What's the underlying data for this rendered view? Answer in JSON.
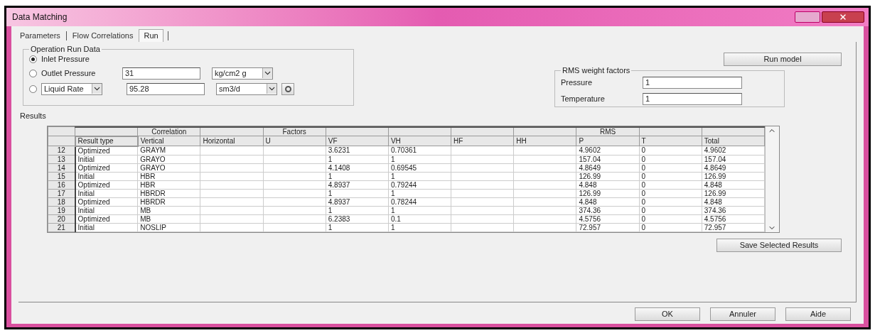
{
  "window": {
    "title": "Data Matching"
  },
  "tabs": [
    {
      "label": "Parameters",
      "selected": false
    },
    {
      "label": "Flow Correlations",
      "selected": false
    },
    {
      "label": "Run",
      "selected": true
    }
  ],
  "operation_run_data": {
    "title": "Operation Run Data",
    "options": [
      {
        "kind": "plain",
        "label": "Inlet Pressure",
        "selected": true
      },
      {
        "kind": "field",
        "label": "Outlet Pressure",
        "selected": false,
        "value": "31",
        "unit": "kg/cm2 g"
      },
      {
        "kind": "quantity",
        "label": "Liquid Rate",
        "selected": false,
        "value": "95.28",
        "unit": "sm3/d"
      }
    ]
  },
  "run_model_button": "Run model",
  "rms_weight_factors": {
    "title": "RMS weight factors",
    "fields": [
      {
        "label": "Pressure",
        "value": "1"
      },
      {
        "label": "Temperature",
        "value": "1"
      }
    ]
  },
  "results": {
    "title": "Results",
    "columns": [
      {
        "label": "Result type"
      },
      {
        "label": "Vertical",
        "group": "Correlation"
      },
      {
        "label": "Horizontal"
      },
      {
        "label": "U",
        "group": "Factors"
      },
      {
        "label": "VF"
      },
      {
        "label": "VH"
      },
      {
        "label": "HF"
      },
      {
        "label": "HH"
      },
      {
        "label": "P",
        "group": "RMS"
      },
      {
        "label": "T"
      },
      {
        "label": "Total"
      }
    ],
    "rows": [
      {
        "number": "12",
        "cells": [
          "Optimized",
          "GRAYM",
          null,
          null,
          "3.6231",
          "0.70361",
          null,
          null,
          "4.9602",
          "0",
          "4.9602"
        ]
      },
      {
        "number": "13",
        "cells": [
          "Initial",
          "GRAYO",
          null,
          null,
          "1",
          "1",
          null,
          null,
          "157.04",
          "0",
          "157.04"
        ]
      },
      {
        "number": "14",
        "cells": [
          "Optimized",
          "GRAYO",
          null,
          null,
          "4.1408",
          "0.69545",
          null,
          null,
          "4.8649",
          "0",
          "4.8649"
        ]
      },
      {
        "number": "15",
        "cells": [
          "Initial",
          "HBR",
          null,
          null,
          "1",
          "1",
          null,
          null,
          "126.99",
          "0",
          "126.99"
        ]
      },
      {
        "number": "16",
        "cells": [
          "Optimized",
          "HBR",
          null,
          null,
          "4.8937",
          "0.79244",
          null,
          null,
          "4.848",
          "0",
          "4.848"
        ]
      },
      {
        "number": "17",
        "cells": [
          "Initial",
          "HBRDR",
          null,
          null,
          "1",
          "1",
          null,
          null,
          "126.99",
          "0",
          "126.99"
        ]
      },
      {
        "number": "18",
        "cells": [
          "Optimized",
          "HBRDR",
          null,
          null,
          "4.8937",
          "0.78244",
          null,
          null,
          "4.848",
          "0",
          "4.848"
        ]
      },
      {
        "number": "19",
        "cells": [
          "Initial",
          "MB",
          null,
          null,
          "1",
          "1",
          null,
          null,
          "374.36",
          "0",
          "374.36"
        ]
      },
      {
        "number": "20",
        "cells": [
          "Optimized",
          "MB",
          null,
          null,
          "6.2383",
          "0.1",
          null,
          null,
          "4.5756",
          "0",
          "4.5756"
        ]
      },
      {
        "number": "21",
        "cells": [
          "Initial",
          "NOSLIP",
          null,
          null,
          "1",
          "1",
          null,
          null,
          "72.957",
          "0",
          "72.957"
        ]
      }
    ]
  },
  "save_button": "Save Selected Results",
  "footer_buttons": [
    "OK",
    "Annuler",
    "Aide"
  ]
}
